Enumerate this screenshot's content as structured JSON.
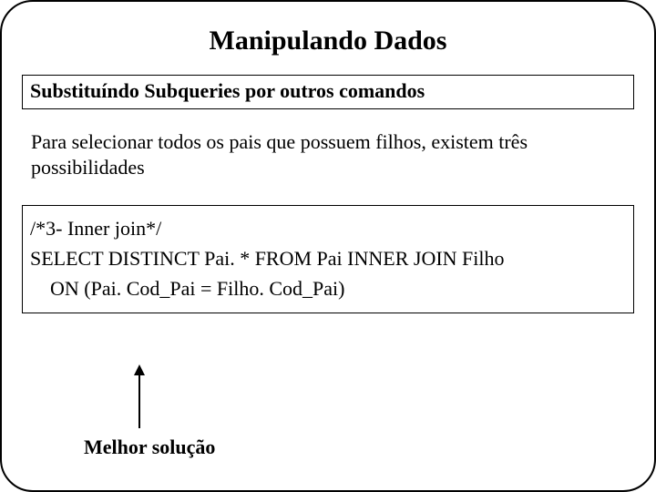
{
  "title": "Manipulando Dados",
  "subtitle": "Substituíndo Subqueries por outros comandos",
  "body": "Para selecionar todos os pais que possuem filhos, existem três possibilidades",
  "code": {
    "line1": "/*3- Inner join*/",
    "line2": "SELECT DISTINCT Pai. * FROM Pai INNER JOIN Filho",
    "line3": "ON (Pai. Cod_Pai = Filho. Cod_Pai)"
  },
  "caption": "Melhor solução"
}
